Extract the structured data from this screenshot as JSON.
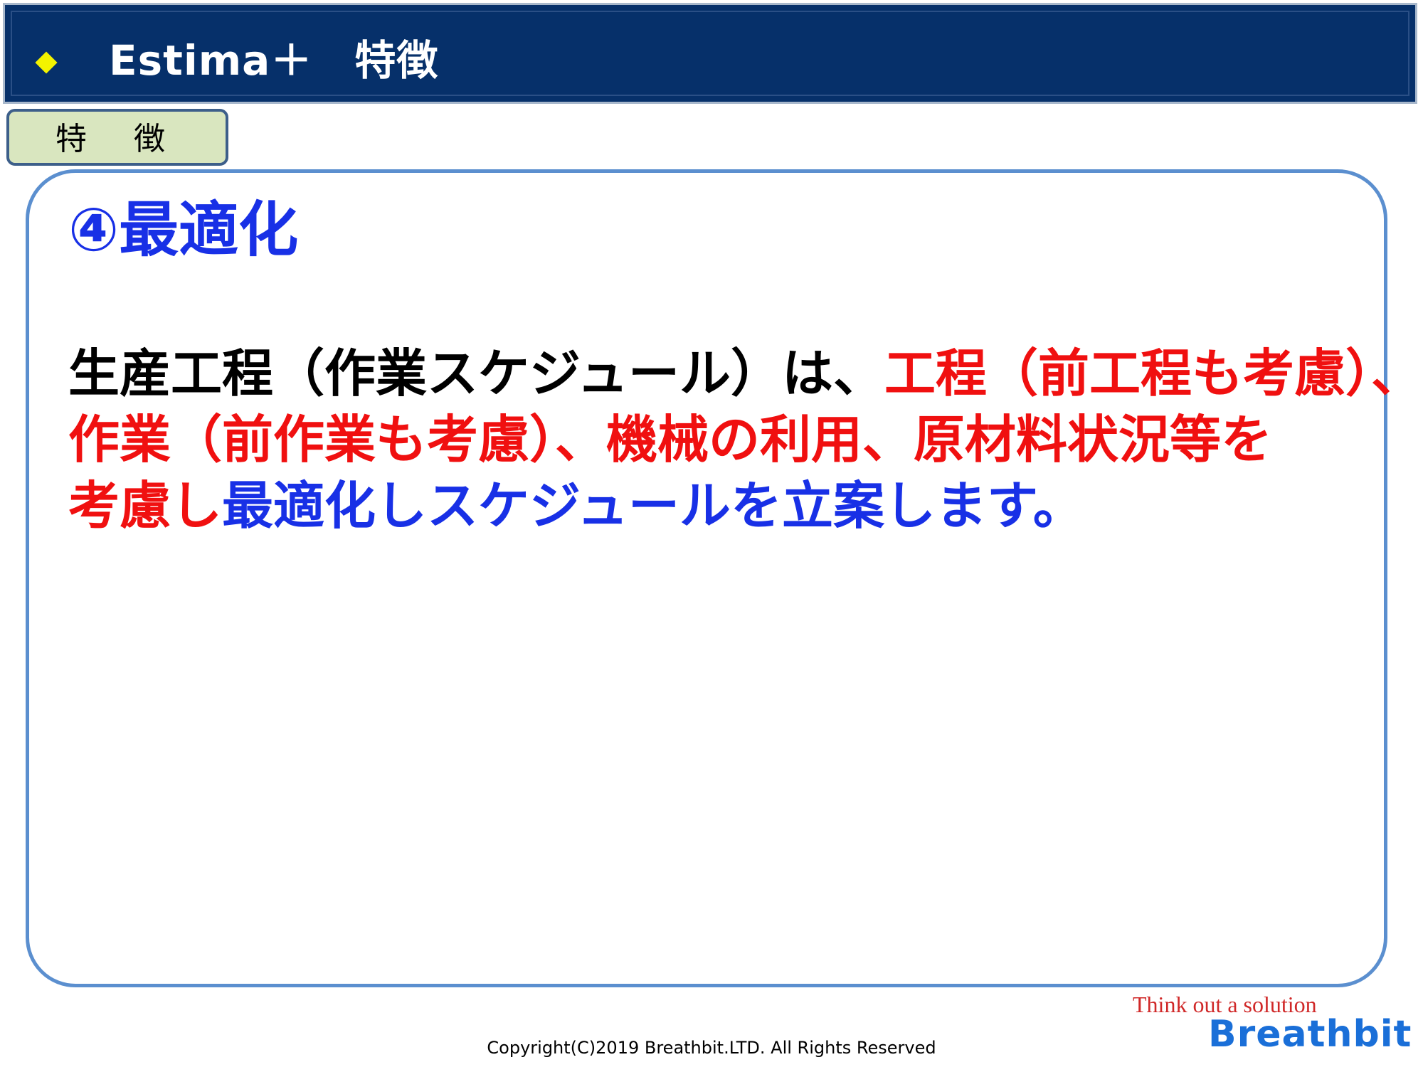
{
  "header": {
    "title": "Estima＋　特徴",
    "bullet_color": "#f3f300",
    "background_color": "#06306a"
  },
  "section_tab": {
    "label": "特 徴",
    "background_color": "#d9e6bf"
  },
  "content": {
    "heading": "④最適化",
    "body": {
      "line1": {
        "black": "生産工程（作業スケジュール）は、",
        "red": "工程（前工程も考慮）、"
      },
      "line2": {
        "red": "作業（前作業も考慮）、機械の利用、原材料状況等を"
      },
      "line3": {
        "red": "考慮し",
        "blue": "最適化しスケジュールを立案します。"
      }
    },
    "colors": {
      "heading": "#1830e6",
      "emphasis_red": "#f01010",
      "emphasis_blue": "#1830e6"
    }
  },
  "footer": {
    "copyright": "Copyright(C)2019 Breathbit.LTD. All Rights Reserved",
    "tagline": "Think out a solution",
    "brand": "Breathbit"
  }
}
